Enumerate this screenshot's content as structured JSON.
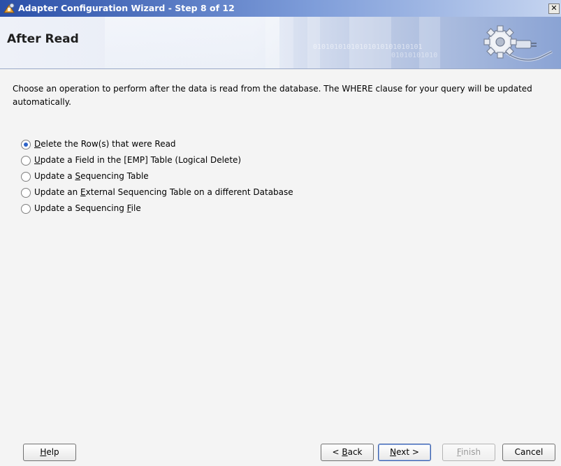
{
  "window": {
    "title": "Adapter Configuration Wizard - Step 8 of 12",
    "close_glyph": "✕"
  },
  "banner": {
    "heading": "After Read",
    "binary_text": "01010101010101010101010101",
    "binary_text2": "01010101010"
  },
  "description": "Choose an operation to perform after the data is read from the database.  The WHERE clause for your query will be updated automatically.",
  "options": [
    {
      "pre": "",
      "mnemonic": "D",
      "post": "elete the Row(s) that were Read",
      "checked": true
    },
    {
      "pre": "",
      "mnemonic": "U",
      "post": "pdate a Field in the [EMP] Table (Logical Delete)",
      "checked": false
    },
    {
      "pre": "Update a ",
      "mnemonic": "S",
      "post": "equencing Table",
      "checked": false
    },
    {
      "pre": "Update an ",
      "mnemonic": "E",
      "post": "xternal Sequencing Table on a different Database",
      "checked": false
    },
    {
      "pre": "Update a Sequencing ",
      "mnemonic": "F",
      "post": "ile",
      "checked": false
    }
  ],
  "buttons": {
    "help": {
      "pre": "",
      "mnemonic": "H",
      "post": "elp"
    },
    "back": {
      "pre": "< ",
      "mnemonic": "B",
      "post": "ack"
    },
    "next": {
      "pre": "",
      "mnemonic": "N",
      "post": "ext >"
    },
    "finish": {
      "pre": "",
      "mnemonic": "F",
      "post": "inish"
    },
    "cancel": {
      "label": "Cancel"
    }
  },
  "icons": {
    "app": "adapter-wizard-icon",
    "banner": "gear-plug-icon"
  },
  "colors": {
    "title_bar": "#2a4fa8",
    "radio_selected": "#2d63c8"
  }
}
